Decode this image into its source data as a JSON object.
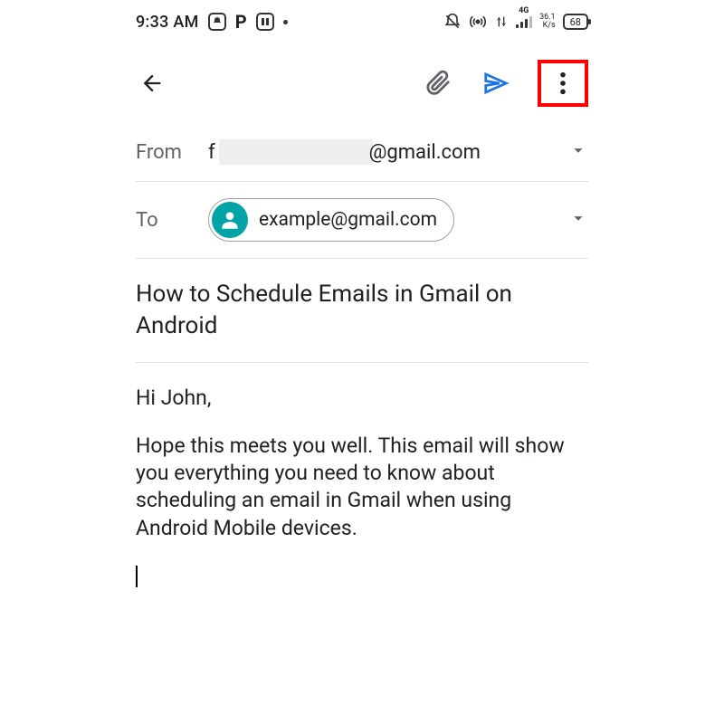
{
  "statusbar": {
    "time": "9:33 AM",
    "network_label": "4G",
    "speed_value": "36.1",
    "speed_unit": "K/s",
    "battery": "68"
  },
  "from": {
    "label": "From",
    "prefix": "f",
    "suffix": "@gmail.com"
  },
  "to": {
    "label": "To",
    "email": "example@gmail.com"
  },
  "subject": "How to Schedule Emails in Gmail on Android",
  "body": {
    "greeting": "Hi John,",
    "paragraph": "Hope this meets you well. This email will show you everything you need to know about scheduling an email in Gmail when using Android Mobile devices."
  }
}
